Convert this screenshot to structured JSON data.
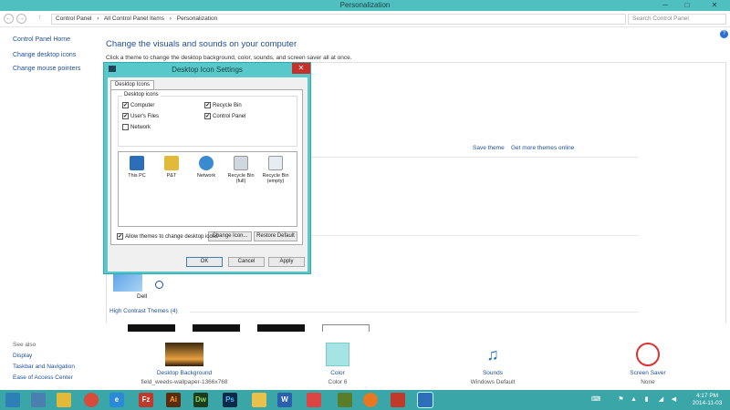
{
  "window": {
    "title": "Personalization",
    "min": "─",
    "max": "□",
    "close": "✕"
  },
  "nav": {
    "back": "←",
    "forward": "→",
    "up": "↑",
    "breadcrumb": [
      "Control Panel",
      "›",
      "All Control Panel Items",
      "›",
      "Personalization"
    ],
    "search_placeholder": "Search Control Panel",
    "help": "?"
  },
  "left_pane": {
    "home": "Control Panel Home",
    "links": [
      "Change desktop icons",
      "Change mouse pointers"
    ],
    "see_also_title": "See also",
    "see_also": [
      "Display",
      "Taskbar and Navigation",
      "Ease of Access Center"
    ]
  },
  "main": {
    "heading": "Change the visuals and sounds on your computer",
    "subtitle": "Click a theme to change the desktop background, color, sounds, and screen saver all at once.",
    "save_theme": "Save theme",
    "get_more": "Get more themes online",
    "dell_label": "Dell",
    "high_contrast": "High Contrast Themes (4)"
  },
  "bottom": {
    "background": {
      "title": "Desktop Background",
      "sub": "field_weeds-wallpaper-1366x768"
    },
    "color": {
      "title": "Color",
      "sub": "Color 6"
    },
    "sounds": {
      "title": "Sounds",
      "sub": "Windows Default",
      "glyph": "♫"
    },
    "screensaver": {
      "title": "Screen Saver",
      "sub": "None"
    }
  },
  "dialog": {
    "title": "Desktop Icon Settings",
    "close": "✕",
    "tab": "Desktop Icons",
    "group_label": "Desktop icons",
    "checkboxes": {
      "computer": {
        "label": "Computer",
        "checked": true
      },
      "recycle": {
        "label": "Recycle Bin",
        "checked": true
      },
      "userfiles": {
        "label": "User's Files",
        "checked": true
      },
      "controlpanel": {
        "label": "Control Panel",
        "checked": true
      },
      "network": {
        "label": "Network",
        "checked": false
      }
    },
    "icons": [
      "This PC",
      "P&T",
      "Network",
      "Recycle Bin (full)",
      "Recycle Bin (empty)"
    ],
    "change_icon": "Change Icon...",
    "restore_default": "Restore Default",
    "allow_themes": "Allow themes to change desktop icons",
    "ok": "OK",
    "cancel": "Cancel",
    "apply": "Apply",
    "check_glyph": "✔"
  },
  "taskbar": {
    "time": "4:17 PM",
    "date": "2014-11-03",
    "apps": [
      "",
      "",
      "",
      "e",
      "Fz",
      "Ai",
      "Dw",
      "Ps",
      "",
      "W",
      "",
      "",
      "",
      "",
      ""
    ]
  },
  "colors": {
    "titlebar": "#4fbfc0",
    "taskbar": "#3aa6a8",
    "link": "#1f4e9b",
    "dialog_frame": "#59c8ca",
    "close_red": "#c7302a"
  }
}
